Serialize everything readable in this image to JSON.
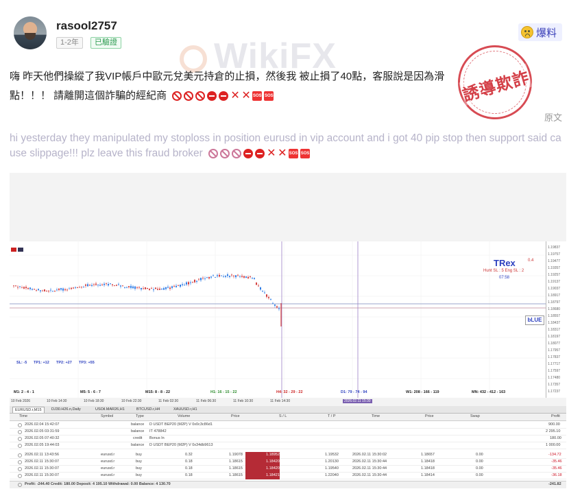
{
  "user": {
    "name": "rasool2757",
    "years_badge": "1-2年",
    "verified_badge": "已驗證"
  },
  "report": {
    "label": "爆料",
    "icon": "sad-face-icon"
  },
  "post": {
    "zh": "嗨 昨天他們操縱了我VIP帳戶中歐元兌美元持倉的止損，然後我 被止損了40點，客服說是因為滑點！！！ 請離開這個詐騙的經紀商",
    "en": "hi yesterday they manipulated my stoploss in position eurusd in vip account and i got 40 pip stop then support said cause slippage!!! plz leave this fraud broker",
    "emoji_sequence": [
      "no-entry-sign-icon",
      "no-entry-sign-icon",
      "no-entry-sign-icon",
      "no-entry-icon",
      "no-entry-icon",
      "cross-mark-icon",
      "cross-mark-icon",
      "sos-icon",
      "sos-icon"
    ],
    "original_label": "原文",
    "stamp_text": "誘導欺詐"
  },
  "watermark": "WikiFX",
  "chart": {
    "overlay_title": "TRex",
    "overlay_value": "0.4",
    "hunt_line": "Hunt SL : 5     Eng SL : 2",
    "clock": "07:58",
    "blue_badge": "bLUE",
    "stats": [
      "SL: -5",
      "TP1: +12",
      "TP2: +27",
      "TP3: +55"
    ],
    "timeframes": [
      "M1: 2 - 4 - 1",
      "M5: 5 - 6 - 7",
      "M15: 8 - 8 - 22",
      "H1: 16 - 15 - 22",
      "H4: 32 - 29 - 22",
      "D1: 79 - 74 - 94",
      "W1: 208 - 166 - 119",
      "MN: 432 - 412 - 163"
    ],
    "dates": [
      "10 Feb 2026",
      "10 Feb 14:30",
      "10 Feb 18:30",
      "10 Feb 22:30",
      "11 Feb 02:30",
      "11 Feb 06:30",
      "11 Feb 10:30",
      "11 Feb 14:30",
      "2026.02.11 15:30"
    ],
    "price_labels": [
      "1.19837",
      "1.19757",
      "1.19477",
      "1.19357",
      "1.19257",
      "1.19137",
      "1.19037",
      "1.18917",
      "1.18797",
      "1.18680",
      "1.18557",
      "1.18437",
      "1.18317",
      "1.18197",
      "1.18077",
      "1.17957",
      "1.17837",
      "1.17717",
      "1.17597",
      "1.17480",
      "1.17357",
      "1.17237"
    ]
  },
  "tabs": [
    "EURUSD.r,M15",
    "DJ30.H26.n,Daily",
    "USOil.MAR26,H1",
    "BTCUSD.r,H4",
    "XAUUSD.r,H1"
  ],
  "table": {
    "headers": [
      "Time",
      "Symbol",
      "Type",
      "Volume",
      "Price",
      "S / L",
      "T / P",
      "Time",
      "Price",
      "Swap",
      "Profit"
    ],
    "balance_rows": [
      {
        "time": "2026.02.04 15:42:07",
        "type": "balance",
        "comment": "D USDT BEP20 (M2P) V 0x0c3c86d1",
        "profit": "900.00"
      },
      {
        "time": "2026.02.05 03:31:59",
        "type": "balance",
        "comment": "IT 478842",
        "profit": "2 295.10"
      },
      {
        "time": "2026.02.05 07:40:32",
        "type": "credit",
        "comment": "Bonus In",
        "profit": "180.00"
      },
      {
        "time": "2026.02.05 19:44:03",
        "type": "balance",
        "comment": "D USDT BEP20 (M2P) V 0x34db9613",
        "profit": "1 000.00"
      }
    ],
    "trade_rows": [
      {
        "time": "2026.02.11 13:43:56",
        "symbol": "eurusd.r",
        "type": "buy",
        "volume": "0.32",
        "price": "1.19078",
        "sl": "1.18952",
        "tp": "1.19532",
        "close_time": "2026.02.11 15:30:02",
        "close_price": "1.18657",
        "swap": "0.00",
        "profit": "-134.72"
      },
      {
        "time": "2026.02.11 15:30:07",
        "symbol": "eurusd.r",
        "type": "buy",
        "volume": "0.18",
        "price": "1.18615",
        "sl": "1.18420",
        "tp": "1.20130",
        "close_time": "2026.02.11 15:30:44",
        "close_price": "1.18418",
        "swap": "0.00",
        "profit": "-35.46"
      },
      {
        "time": "2026.02.11 15:30:07",
        "symbol": "eurusd.r",
        "type": "buy",
        "volume": "0.18",
        "price": "1.18615",
        "sl": "1.18420",
        "tp": "1.19540",
        "close_time": "2026.02.11 15:30:44",
        "close_price": "1.18418",
        "swap": "0.00",
        "profit": "-35.46"
      },
      {
        "time": "2026.02.11 15:30:07",
        "symbol": "eurusd.r",
        "type": "buy",
        "volume": "0.18",
        "price": "1.18615",
        "sl": "1.18421",
        "tp": "1.22040",
        "close_time": "2026.02.11 15:30:44",
        "close_price": "1.18414",
        "swap": "0.00",
        "profit": "-36.18"
      }
    ],
    "footer": "Profit: -244.40  Credit: 180.00  Deposit: 4 195.10  Withdrawal: 0.00  Balance: 4 130.70",
    "footer_profit": "-241.82"
  }
}
